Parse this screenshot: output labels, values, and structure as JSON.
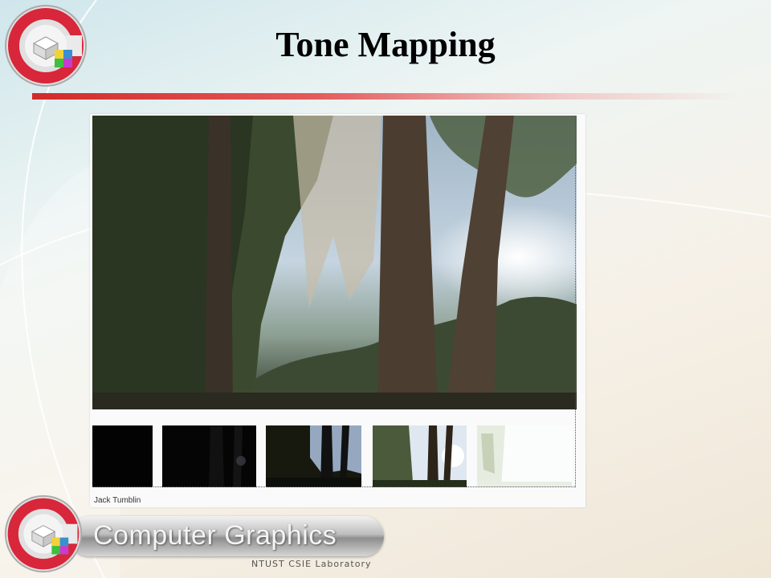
{
  "slide": {
    "title": "Tone Mapping"
  },
  "figure": {
    "credit": "Jack Tumblin",
    "exposure_strip_count": 5
  },
  "branding": {
    "name": "Computer Graphics",
    "subtitle": "NTUST CSIE Laboratory"
  },
  "colors": {
    "title_rule": "#d22a2a",
    "logo_ring": "#d8263a"
  }
}
